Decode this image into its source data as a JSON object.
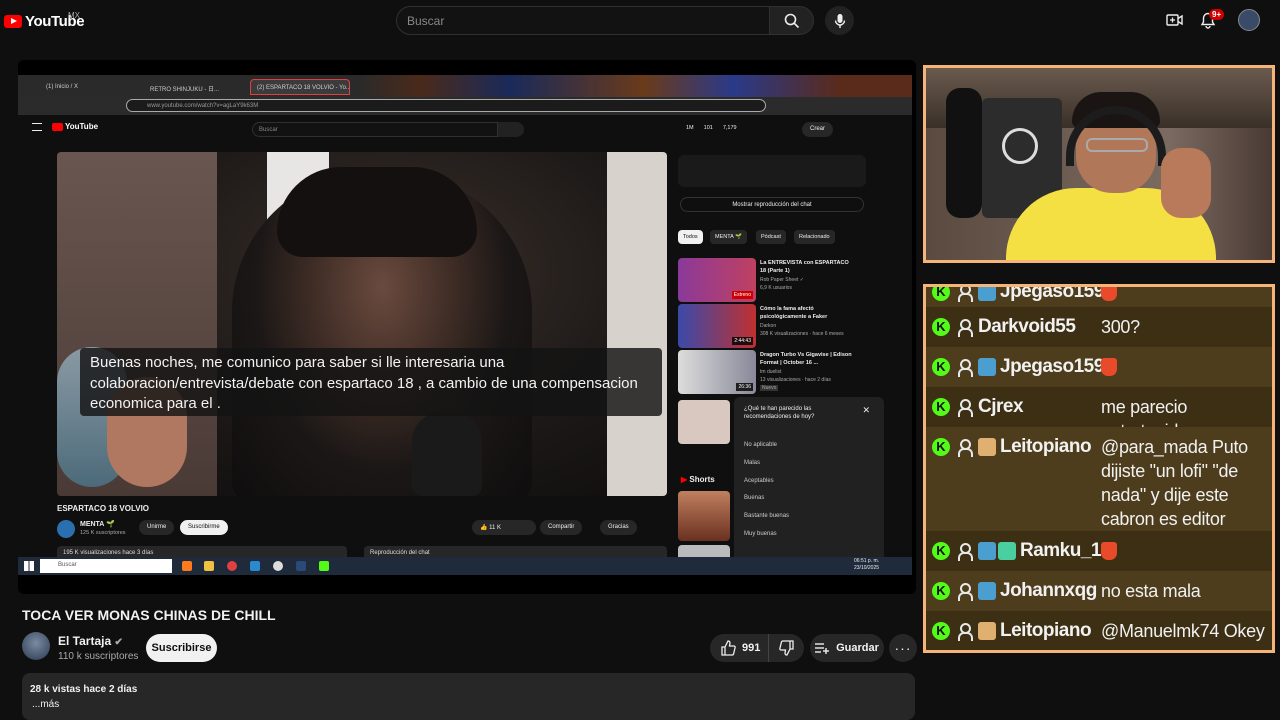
{
  "header": {
    "logo_text": "YouTube",
    "region": "MX",
    "search_placeholder": "Buscar",
    "notif_count": "9+"
  },
  "screen": {
    "tabs": [
      "(1) Inicio / X",
      "RETRO SHINJUKU - 日...",
      "(2) ESPARTACO 18 VOLVIO - Yo..."
    ],
    "url": "www.youtube.com/watch?v=agLaY9k63M",
    "inner_logo": "YouTube",
    "inner_search": "Buscar",
    "header_counts": [
      "1M",
      "101",
      "7,179"
    ],
    "create_label": "Crear",
    "caption": "Buenas noches, me comunico para saber si lle interesaria una colaboracion/entrevista/debate con espartaco 18 , a cambio de una compensacion economica para el .",
    "video_title": "ESPARTACO 18 VOLVIO",
    "channel_name": "MENTA 🌱",
    "channel_subs": "125 K suscriptores",
    "join_label": "Unirme",
    "subscribe_label": "Suscribirme",
    "likes": "11 K",
    "share_label": "Compartir",
    "thanks_label": "Gracias",
    "views_bar": "195 K visualizaciones  hace 3 días",
    "chat_replay_bar": "Reproducción del chat",
    "show_chat_replay": "Mostrar reproducción del chat",
    "chips": [
      "Todos",
      "MENTA 🌱",
      "Pódcast",
      "Relacionado"
    ],
    "recs": [
      {
        "title": "La ENTREVISTA con ESPARTACO 18 (Parte 1)",
        "channel": "Rob Paper Sheet ✓",
        "meta": "6,9 K usuarios",
        "duration": "Estreno"
      },
      {
        "title": "Cómo la fama afectó psicológicamente a Faker",
        "channel": "Darkon",
        "meta": "308 K visualizaciones · hace 6 meses",
        "duration": "2:44:43"
      },
      {
        "title": "Dragon Turbo Vs Gigavise | Edison Format | October 16 ...",
        "channel": "tm duelist",
        "meta": "13 visualizaciones · hace 2 días",
        "duration": "26:36",
        "badge": "Nuevo"
      }
    ],
    "survey_question": "¿Qué te han parecido las recomendaciones de hoy?",
    "survey_options": [
      "No aplicable",
      "Malas",
      "Aceptables",
      "Buenas",
      "Bastante buenas",
      "Muy buenas"
    ],
    "shorts_label": "Shorts",
    "taskbar_search": "Buscar",
    "taskbar_time": "06:51 p. m.",
    "taskbar_date": "23/10/2025"
  },
  "main": {
    "title": "TOCA VER MONAS CHINAS DE CHILL",
    "channel": "El Tartaja",
    "subs": "110 k suscriptores",
    "subscribe_label": "Suscribirse",
    "likes": "991",
    "save_label": "Guardar",
    "stats": "28 k vistas  hace 2 días",
    "more": "...más"
  },
  "chat": {
    "messages": [
      {
        "user": "Jpegaso159",
        "text": "",
        "emote_color": "#4a9fd0",
        "fire": true
      },
      {
        "user": "Darkvoid55",
        "text": "300?",
        "emote_color": "",
        "fire": false
      },
      {
        "user": "Jpegaso159",
        "text": "",
        "emote_color": "#4a9fd0",
        "fire": true
      },
      {
        "user": "Cjrex",
        "text": "me parecio entretenido",
        "emote_color": "",
        "fire": false
      },
      {
        "user": "Leitopiano",
        "text": "@para_mada Puto dijiste \"un lofi\" \"de nada\" y dije este cabron es editor jajaaj",
        "emote_color": "#e0b070",
        "fire": false
      },
      {
        "user": "Ramku_1",
        "text": "",
        "emote_color": "#4a9fd0",
        "fire": true
      },
      {
        "user": "Johannxqg",
        "text": "no esta mala",
        "emote_color": "#4a9fd0",
        "fire": false
      },
      {
        "user": "Leitopiano",
        "text": "@Manuelmk74 Okey",
        "emote_color": "#e0b070",
        "fire": false
      }
    ]
  },
  "colors": {
    "accent": "#ff0000",
    "kick_green": "#53fc18",
    "frame_orange": "#f5b47a"
  }
}
